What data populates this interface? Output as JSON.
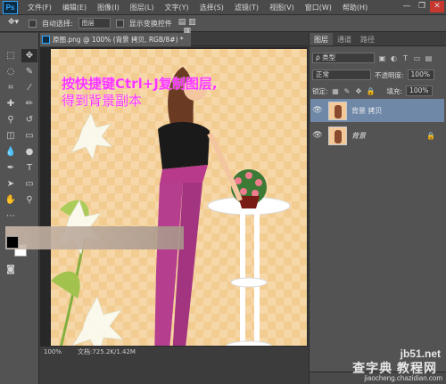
{
  "app": {
    "logo": "Ps"
  },
  "menu": [
    "文件(F)",
    "编辑(E)",
    "图像(I)",
    "图层(L)",
    "文字(Y)",
    "选择(S)",
    "滤镜(T)",
    "视图(V)",
    "窗口(W)",
    "帮助(H)"
  ],
  "window_controls": {
    "minimize": "—",
    "maximize": "❐",
    "close": "✕"
  },
  "options_bar": {
    "tool_icon": "move-tool",
    "auto_select_label": "自动选择:",
    "auto_select_value": "图层",
    "show_transform_label": "显示变换控件"
  },
  "document": {
    "tab_title": "原图.png @ 100% (背景 拷贝, RGB/8#) *",
    "caption_line1": "按快捷键Ctrl+J复制图层,",
    "caption_line2": "得到背景副本"
  },
  "status": {
    "zoom": "100%",
    "doc_info": "文档:725.2K/1.42M"
  },
  "panels": {
    "tabs": [
      "图层",
      "通道",
      "路径"
    ],
    "kind_filter": "ρ 类型",
    "blend_mode": "正常",
    "opacity_label": "不透明度:",
    "opacity_value": "100%",
    "lock_label": "锁定:",
    "fill_label": "填充:",
    "fill_value": "100%",
    "layers": [
      {
        "name": "背景 拷贝",
        "selected": true,
        "locked": false
      },
      {
        "name": "背景",
        "selected": false,
        "locked": true
      }
    ]
  },
  "watermark": {
    "line1": "jb51.net",
    "line2": "查字典 教程网",
    "line3": "jiaocheng.chazidian.com"
  }
}
